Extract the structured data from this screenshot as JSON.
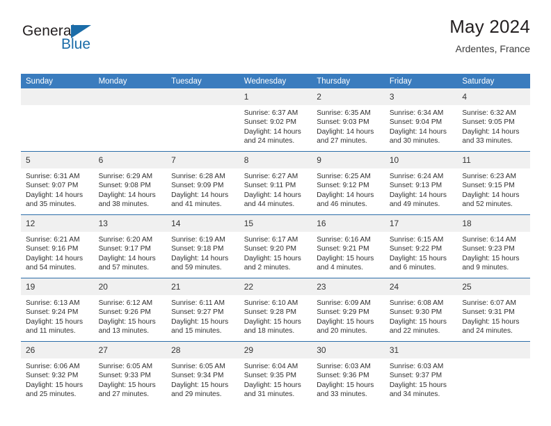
{
  "brand": {
    "name_top": "General",
    "name_bottom": "Blue",
    "triangle_color": "#1b6ca8"
  },
  "header": {
    "title": "May 2024",
    "location": "Ardentes, France"
  },
  "theme": {
    "header_blue": "#3a7cbe",
    "separator_blue": "#2a6ca8",
    "daynum_gray": "#f0f0f0"
  },
  "weekdays": [
    "Sunday",
    "Monday",
    "Tuesday",
    "Wednesday",
    "Thursday",
    "Friday",
    "Saturday"
  ],
  "weeks": [
    [
      {
        "day": "",
        "empty": true
      },
      {
        "day": "",
        "empty": true
      },
      {
        "day": "",
        "empty": true
      },
      {
        "day": "1",
        "sunrise": "Sunrise: 6:37 AM",
        "sunset": "Sunset: 9:02 PM",
        "daylight1": "Daylight: 14 hours",
        "daylight2": "and 24 minutes."
      },
      {
        "day": "2",
        "sunrise": "Sunrise: 6:35 AM",
        "sunset": "Sunset: 9:03 PM",
        "daylight1": "Daylight: 14 hours",
        "daylight2": "and 27 minutes."
      },
      {
        "day": "3",
        "sunrise": "Sunrise: 6:34 AM",
        "sunset": "Sunset: 9:04 PM",
        "daylight1": "Daylight: 14 hours",
        "daylight2": "and 30 minutes."
      },
      {
        "day": "4",
        "sunrise": "Sunrise: 6:32 AM",
        "sunset": "Sunset: 9:05 PM",
        "daylight1": "Daylight: 14 hours",
        "daylight2": "and 33 minutes."
      }
    ],
    [
      {
        "day": "5",
        "sunrise": "Sunrise: 6:31 AM",
        "sunset": "Sunset: 9:07 PM",
        "daylight1": "Daylight: 14 hours",
        "daylight2": "and 35 minutes."
      },
      {
        "day": "6",
        "sunrise": "Sunrise: 6:29 AM",
        "sunset": "Sunset: 9:08 PM",
        "daylight1": "Daylight: 14 hours",
        "daylight2": "and 38 minutes."
      },
      {
        "day": "7",
        "sunrise": "Sunrise: 6:28 AM",
        "sunset": "Sunset: 9:09 PM",
        "daylight1": "Daylight: 14 hours",
        "daylight2": "and 41 minutes."
      },
      {
        "day": "8",
        "sunrise": "Sunrise: 6:27 AM",
        "sunset": "Sunset: 9:11 PM",
        "daylight1": "Daylight: 14 hours",
        "daylight2": "and 44 minutes."
      },
      {
        "day": "9",
        "sunrise": "Sunrise: 6:25 AM",
        "sunset": "Sunset: 9:12 PM",
        "daylight1": "Daylight: 14 hours",
        "daylight2": "and 46 minutes."
      },
      {
        "day": "10",
        "sunrise": "Sunrise: 6:24 AM",
        "sunset": "Sunset: 9:13 PM",
        "daylight1": "Daylight: 14 hours",
        "daylight2": "and 49 minutes."
      },
      {
        "day": "11",
        "sunrise": "Sunrise: 6:23 AM",
        "sunset": "Sunset: 9:15 PM",
        "daylight1": "Daylight: 14 hours",
        "daylight2": "and 52 minutes."
      }
    ],
    [
      {
        "day": "12",
        "sunrise": "Sunrise: 6:21 AM",
        "sunset": "Sunset: 9:16 PM",
        "daylight1": "Daylight: 14 hours",
        "daylight2": "and 54 minutes."
      },
      {
        "day": "13",
        "sunrise": "Sunrise: 6:20 AM",
        "sunset": "Sunset: 9:17 PM",
        "daylight1": "Daylight: 14 hours",
        "daylight2": "and 57 minutes."
      },
      {
        "day": "14",
        "sunrise": "Sunrise: 6:19 AM",
        "sunset": "Sunset: 9:18 PM",
        "daylight1": "Daylight: 14 hours",
        "daylight2": "and 59 minutes."
      },
      {
        "day": "15",
        "sunrise": "Sunrise: 6:17 AM",
        "sunset": "Sunset: 9:20 PM",
        "daylight1": "Daylight: 15 hours",
        "daylight2": "and 2 minutes."
      },
      {
        "day": "16",
        "sunrise": "Sunrise: 6:16 AM",
        "sunset": "Sunset: 9:21 PM",
        "daylight1": "Daylight: 15 hours",
        "daylight2": "and 4 minutes."
      },
      {
        "day": "17",
        "sunrise": "Sunrise: 6:15 AM",
        "sunset": "Sunset: 9:22 PM",
        "daylight1": "Daylight: 15 hours",
        "daylight2": "and 6 minutes."
      },
      {
        "day": "18",
        "sunrise": "Sunrise: 6:14 AM",
        "sunset": "Sunset: 9:23 PM",
        "daylight1": "Daylight: 15 hours",
        "daylight2": "and 9 minutes."
      }
    ],
    [
      {
        "day": "19",
        "sunrise": "Sunrise: 6:13 AM",
        "sunset": "Sunset: 9:24 PM",
        "daylight1": "Daylight: 15 hours",
        "daylight2": "and 11 minutes."
      },
      {
        "day": "20",
        "sunrise": "Sunrise: 6:12 AM",
        "sunset": "Sunset: 9:26 PM",
        "daylight1": "Daylight: 15 hours",
        "daylight2": "and 13 minutes."
      },
      {
        "day": "21",
        "sunrise": "Sunrise: 6:11 AM",
        "sunset": "Sunset: 9:27 PM",
        "daylight1": "Daylight: 15 hours",
        "daylight2": "and 15 minutes."
      },
      {
        "day": "22",
        "sunrise": "Sunrise: 6:10 AM",
        "sunset": "Sunset: 9:28 PM",
        "daylight1": "Daylight: 15 hours",
        "daylight2": "and 18 minutes."
      },
      {
        "day": "23",
        "sunrise": "Sunrise: 6:09 AM",
        "sunset": "Sunset: 9:29 PM",
        "daylight1": "Daylight: 15 hours",
        "daylight2": "and 20 minutes."
      },
      {
        "day": "24",
        "sunrise": "Sunrise: 6:08 AM",
        "sunset": "Sunset: 9:30 PM",
        "daylight1": "Daylight: 15 hours",
        "daylight2": "and 22 minutes."
      },
      {
        "day": "25",
        "sunrise": "Sunrise: 6:07 AM",
        "sunset": "Sunset: 9:31 PM",
        "daylight1": "Daylight: 15 hours",
        "daylight2": "and 24 minutes."
      }
    ],
    [
      {
        "day": "26",
        "sunrise": "Sunrise: 6:06 AM",
        "sunset": "Sunset: 9:32 PM",
        "daylight1": "Daylight: 15 hours",
        "daylight2": "and 25 minutes."
      },
      {
        "day": "27",
        "sunrise": "Sunrise: 6:05 AM",
        "sunset": "Sunset: 9:33 PM",
        "daylight1": "Daylight: 15 hours",
        "daylight2": "and 27 minutes."
      },
      {
        "day": "28",
        "sunrise": "Sunrise: 6:05 AM",
        "sunset": "Sunset: 9:34 PM",
        "daylight1": "Daylight: 15 hours",
        "daylight2": "and 29 minutes."
      },
      {
        "day": "29",
        "sunrise": "Sunrise: 6:04 AM",
        "sunset": "Sunset: 9:35 PM",
        "daylight1": "Daylight: 15 hours",
        "daylight2": "and 31 minutes."
      },
      {
        "day": "30",
        "sunrise": "Sunrise: 6:03 AM",
        "sunset": "Sunset: 9:36 PM",
        "daylight1": "Daylight: 15 hours",
        "daylight2": "and 33 minutes."
      },
      {
        "day": "31",
        "sunrise": "Sunrise: 6:03 AM",
        "sunset": "Sunset: 9:37 PM",
        "daylight1": "Daylight: 15 hours",
        "daylight2": "and 34 minutes."
      },
      {
        "day": "",
        "empty": true
      }
    ]
  ]
}
